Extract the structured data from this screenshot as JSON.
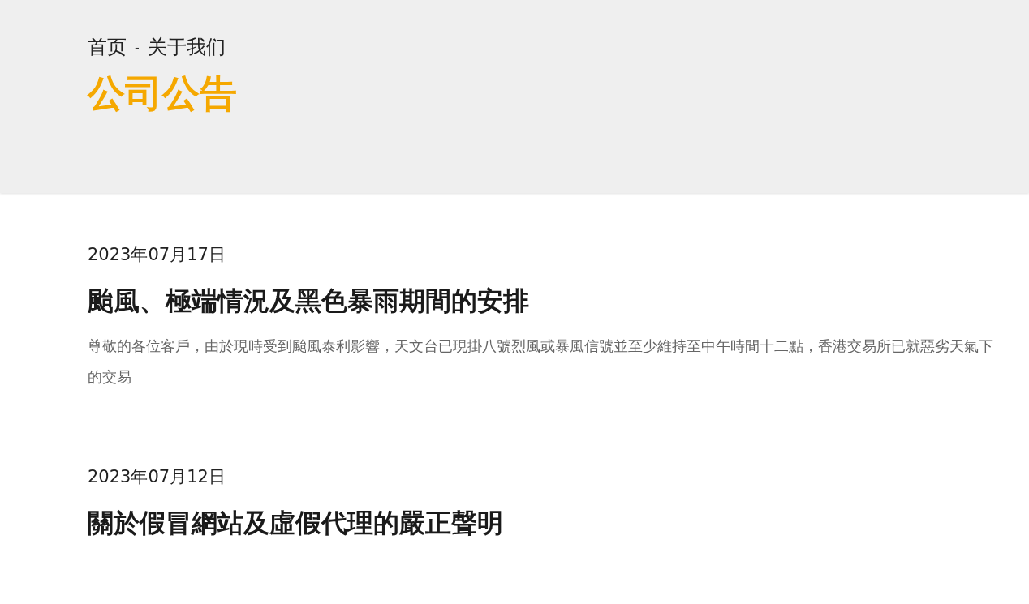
{
  "breadcrumb": [
    {
      "label": "首页"
    },
    {
      "label": "关于我们"
    }
  ],
  "breadcrumb_separator": "-",
  "page_title": "公司公告",
  "announcements": [
    {
      "date": "2023年07月17日",
      "title": "颱風、極端情況及黑色暴雨期間的安排",
      "summary": "尊敬的各位客戶，由於現時受到颱風泰利影響，天文台已現掛八號烈風或暴風信號並至少維持至中午時間十二點，香港交易所已就惡劣天氣下的交易"
    },
    {
      "date": "2023年07月12日",
      "title": "關於假冒網站及虛假代理的嚴正聲明"
    }
  ]
}
